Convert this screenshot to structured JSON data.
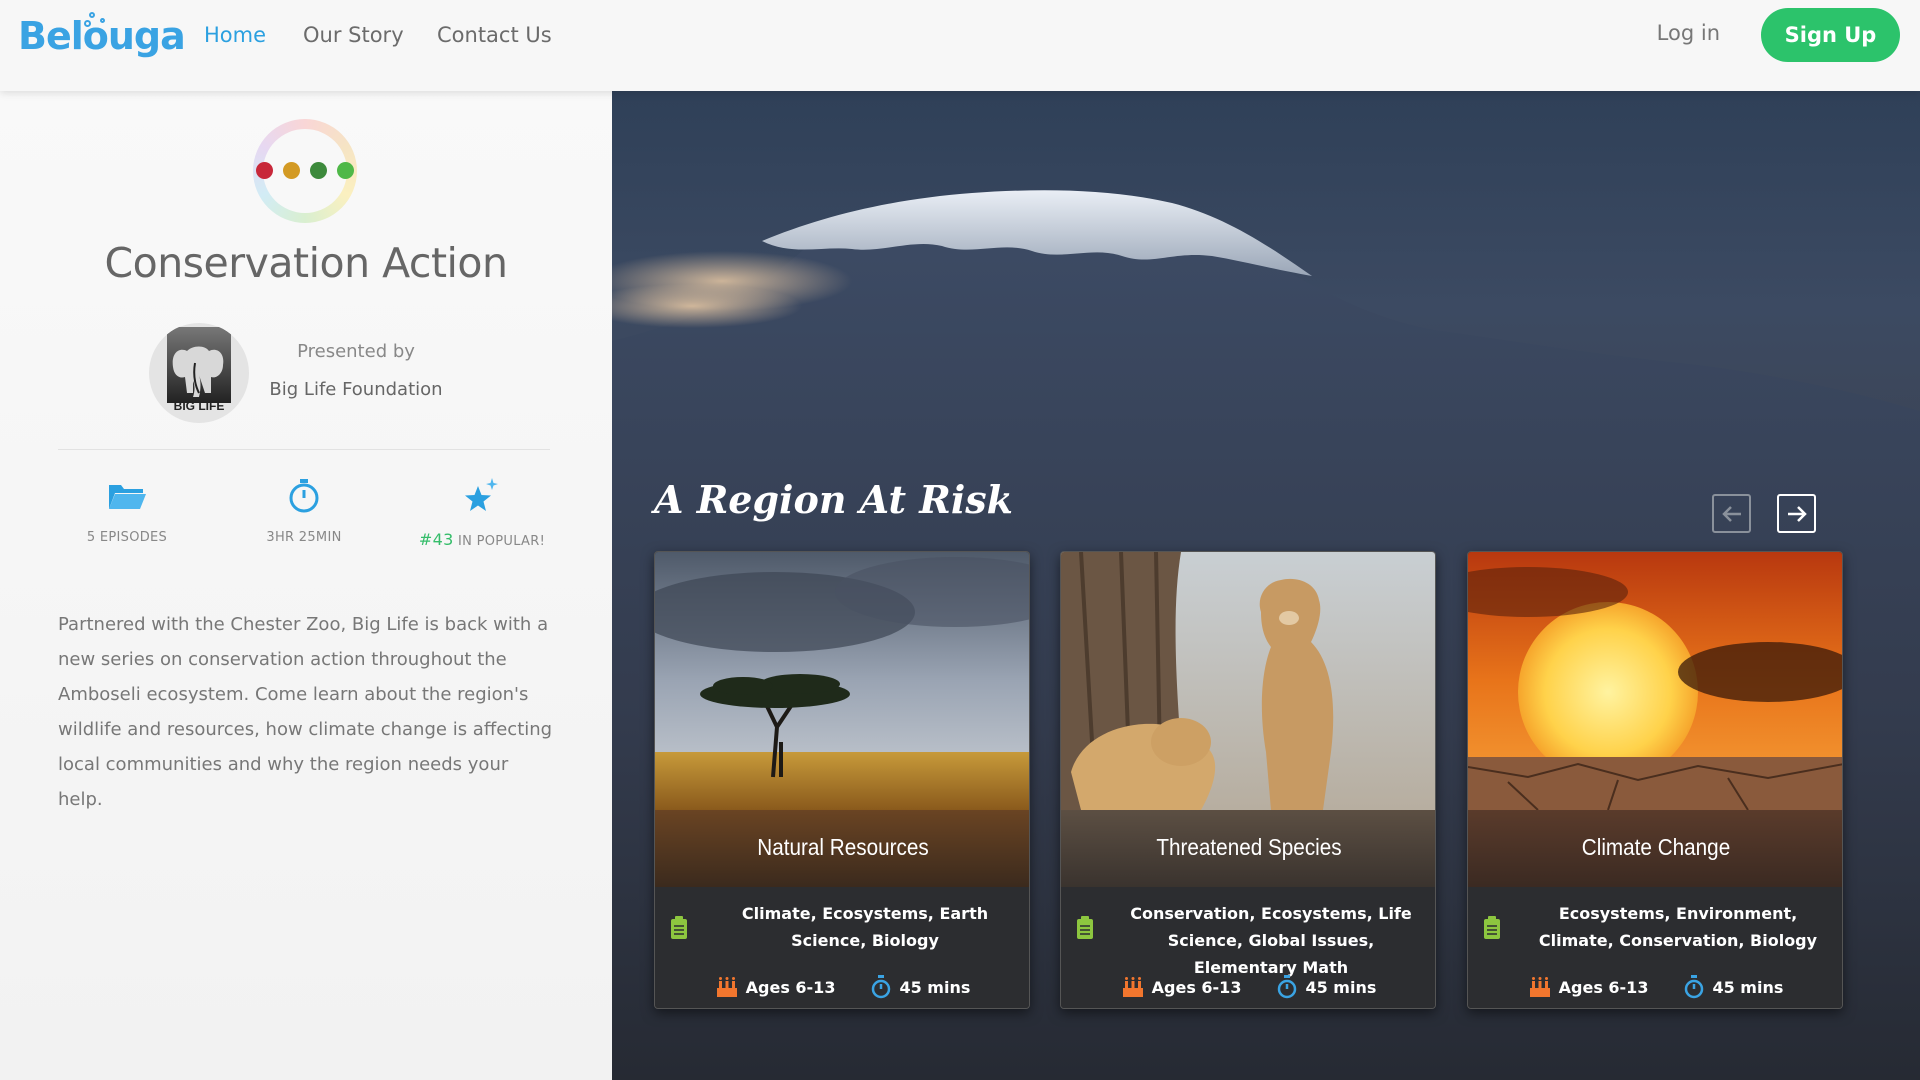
{
  "brand": {
    "name": "Belouga",
    "color": "#3aa3e3"
  },
  "nav": {
    "links": [
      {
        "label": "Home",
        "active": true
      },
      {
        "label": "Our Story",
        "active": false
      },
      {
        "label": "Contact Us",
        "active": false
      }
    ],
    "login_label": "Log in",
    "signup_label": "Sign Up"
  },
  "series": {
    "title": "Conservation Action",
    "presented_by_label": "Presented by",
    "presenter": "Big Life Foundation",
    "avatar_text": "BIG LIFE",
    "stats": {
      "episodes": "5 EPISODES",
      "duration": "3HR 25MIN",
      "rank": "#43",
      "rank_suffix": "IN POPULAR!"
    },
    "description": "Partnered with the Chester Zoo, Big Life is back with a new series on conservation action throughout the Amboseli ecosystem. Come learn about the region's wildlife and resources, how climate change is affecting local communities and why the region needs your help."
  },
  "section": {
    "title": "A Region At Risk"
  },
  "cards": [
    {
      "title": "Natural Resources",
      "topics": "Climate, Ecosystems, Earth Science, Biology",
      "ages": "Ages 6-13",
      "duration": "45 mins"
    },
    {
      "title": "Threatened Species",
      "topics": "Conservation, Ecosystems, Life Science, Global Issues, Elementary Math",
      "ages": "Ages 6-13",
      "duration": "45 mins"
    },
    {
      "title": "Climate Change",
      "topics": "Ecosystems, Environment, Climate, Conservation, Biology",
      "ages": "Ages 6-13",
      "duration": "45 mins"
    }
  ],
  "colors": {
    "accent_blue": "#2ba0e0",
    "signup_green": "#2cc36b",
    "rank_green": "#35bd6a",
    "dot_colors": [
      "#c8283a",
      "#d39a24",
      "#3d8a3c",
      "#4fb848"
    ]
  }
}
